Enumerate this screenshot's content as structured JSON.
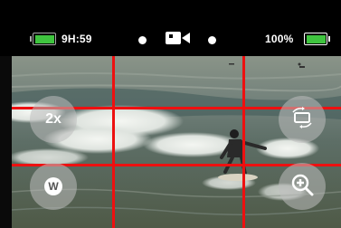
{
  "status": {
    "recording_time": "9H:59",
    "battery_percent": "100%",
    "battery_color": "#3fc43f"
  },
  "controls": {
    "zoom_label": "2x",
    "white_balance_label": "W"
  },
  "colors": {
    "grid_line": "#ee1010",
    "button_bg": "rgba(190,190,190,0.55)"
  },
  "icons": {
    "camera_mode": "video-camera-icon",
    "rotate": "rotate-screen-icon",
    "zoom_in": "zoom-in-icon"
  }
}
